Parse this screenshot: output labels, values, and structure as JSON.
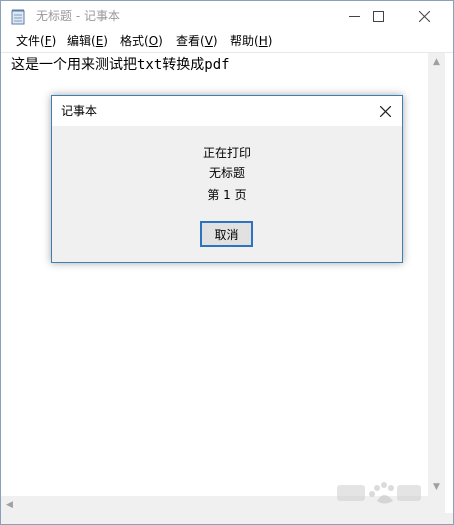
{
  "window": {
    "title": "无标题 - 记事本",
    "app_icon": "notepad-icon",
    "controls": [
      "minimize-icon",
      "maximize-icon",
      "close-icon"
    ]
  },
  "menu": [
    {
      "name": "file",
      "label": "文件(",
      "key": "F",
      "end": ")"
    },
    {
      "name": "edit",
      "label": "编辑(",
      "key": "E",
      "end": ")"
    },
    {
      "name": "format",
      "label": "格式(",
      "key": "O",
      "end": ")"
    },
    {
      "name": "view",
      "label": "查看(",
      "key": "V",
      "end": ")"
    },
    {
      "name": "help",
      "label": "帮助(",
      "key": "H",
      "end": ")"
    }
  ],
  "editor": {
    "content": "这是一个用来测试把txt转换成pdf"
  },
  "dialog": {
    "title": "记事本",
    "status": "正在打印",
    "document": "无标题",
    "page": "第 1 页",
    "cancel_label": "取消"
  },
  "colors": {
    "dialog_border": "#3c7fb1",
    "button_border": "#2c74c0",
    "title_text": "#999999"
  }
}
